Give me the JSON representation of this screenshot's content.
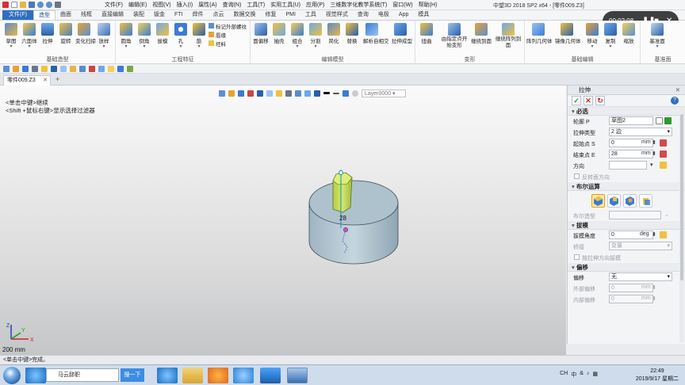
{
  "app": {
    "title": "中望3D 2018 SP2 x64 - [零件009.Z3]",
    "menu": [
      "文件(F)",
      "编辑(E)",
      "视图(V)",
      "插入(I)",
      "属性(A)",
      "查询(N)",
      "工具(T)",
      "实用工具(U)",
      "应用(P)",
      "三维数字化教学系统(T)",
      "窗口(W)",
      "帮助(H)"
    ]
  },
  "ribbon": {
    "tabs": [
      "文件(F)",
      "造型",
      "曲面",
      "线框",
      "直接编辑",
      "装配",
      "钣金",
      "FTI",
      "焊件",
      "点云",
      "数据交换",
      "修复",
      "PMI",
      "工具",
      "视觉样式",
      "查询",
      "电极",
      "App",
      "模具"
    ],
    "active_tab": "造型",
    "groups": [
      {
        "label": "基础造型",
        "buttons": [
          "草图",
          "六面体",
          "拉伸",
          "旋转",
          "变化扫掠",
          "放样"
        ]
      },
      {
        "label": "工程特征",
        "buttons": [
          "圆角",
          "倒角",
          "拔模",
          "孔",
          "筋"
        ],
        "small": [
          "标记外部螺纹",
          "唇缘",
          "坯料"
        ]
      },
      {
        "label": "编辑模型",
        "buttons": [
          "面偏移",
          "抽壳",
          "组合",
          "分割",
          "简化",
          "替换",
          "解析自相交",
          "拉伸成型"
        ]
      },
      {
        "label": "变形",
        "buttons": [
          "扭曲",
          "由指定点开始变形",
          "缠绕到面",
          "缠绕阵列到面"
        ]
      },
      {
        "label": "基础编辑",
        "buttons": [
          "阵列几何体",
          "镜像几何体",
          "移动",
          "复制",
          "缩放"
        ]
      },
      {
        "label": "基准面",
        "buttons": [
          "基准面"
        ]
      }
    ]
  },
  "document": {
    "tab": "零件009.Z3"
  },
  "viewport": {
    "layer_placeholder": "Layer0000",
    "hint_line1": "<单击中键>继续",
    "hint_line2": "<Shift +鼠标右键>显示选择过滤器",
    "dimension_label": "28",
    "scale_label": "200 mm",
    "axis_labels": {
      "x": "X",
      "y": "Y",
      "z": "Z"
    }
  },
  "panel": {
    "title": "拉伸",
    "sections": {
      "required": "必选",
      "boolean": "布尔运算",
      "draft": "拔模",
      "offset": "偏移"
    },
    "fields": {
      "profile_label": "轮廓 P",
      "profile_value": "草图2",
      "extrude_type_label": "拉伸类型",
      "extrude_type_value": "2 边",
      "start_label": "起始点 S",
      "start_value": "0",
      "start_unit": "mm",
      "end_label": "结束点 E",
      "end_value": "28",
      "end_unit": "mm",
      "direction_label": "方向",
      "direction_value": "",
      "reverse_label": "反转面方向",
      "boolean_model_label": "布尔造型",
      "draft_angle_label": "拔模角度",
      "draft_angle_value": "0",
      "draft_angle_unit": "deg",
      "bridge_label": "桥接",
      "bridge_value": "变量",
      "draft_by_dir_label": "按拉伸方向拔模",
      "offset_label": "偏移",
      "offset_value": "无",
      "outer_offset_label": "外部偏移",
      "outer_offset_value": "0",
      "outer_offset_unit": "mm",
      "inner_offset_label": "内部偏移",
      "inner_offset_value": "0",
      "inner_offset_unit": "mm"
    }
  },
  "status": {
    "text": "<单击中键>完成。"
  },
  "taskbar": {
    "search_value": "马云辞职",
    "search_button": "搜一下",
    "tray": [
      "CH",
      "中",
      "&"
    ],
    "time": "22:49",
    "date": "2019/9/17 星期二"
  },
  "recorder": {
    "time": "00:02:08"
  },
  "colors": {
    "accent": "#2f6fbf",
    "part_body": "#b4c7d1",
    "extrusion": "#c9e04a"
  }
}
